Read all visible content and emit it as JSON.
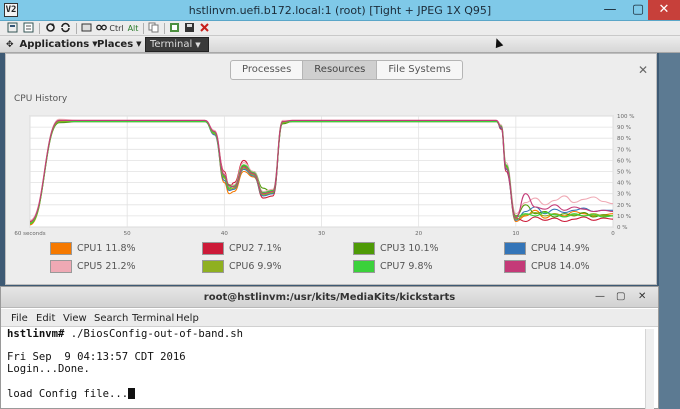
{
  "vnc": {
    "title": "hstlinvm.uefi.b172.local:1 (root) [Tight + JPEG 1X Q95]",
    "app_icon": "V2",
    "controls": {
      "minimize": "—",
      "maximize": "▢",
      "close": "✕"
    },
    "toolbar": {
      "icons": [
        "options-icon",
        "info-icon",
        "refresh-icon",
        "refresh-alt-icon",
        "ctrl-alt-del-icon",
        "ctrl-esc-icon",
        "ctrl-icon",
        "alt-icon",
        "copy-icon",
        "paste-icon",
        "new-connection-icon",
        "save-icon",
        "disconnect-icon"
      ],
      "ctrl_label": "Ctrl",
      "alt_label": "Alt"
    }
  },
  "panel": {
    "applications": "Applications",
    "places": "Places",
    "terminal_tasklist": "Terminal"
  },
  "sysmon": {
    "tabs": [
      "Processes",
      "Resources",
      "File Systems"
    ],
    "active_tab": "Resources",
    "section_title": "CPU History",
    "close_glyph": "✕"
  },
  "chart_data": {
    "type": "line",
    "title": "CPU History",
    "x_ticks": [
      "60 seconds",
      "50",
      "40",
      "30",
      "20",
      "10",
      "0"
    ],
    "y_ticks": [
      "100 %",
      "90 %",
      "80 %",
      "70 %",
      "60 %",
      "50 %",
      "40 %",
      "30 %",
      "20 %",
      "10 %",
      "0 %"
    ],
    "x_range": [
      60,
      0
    ],
    "ylim": [
      0,
      100
    ],
    "grid": true,
    "legend_position": "bottom",
    "x": [
      60,
      57,
      55,
      50,
      45,
      42,
      41,
      40,
      39.5,
      39,
      38,
      37,
      36,
      35,
      34,
      33,
      32,
      31,
      25,
      20,
      15,
      12,
      11.5,
      11,
      10,
      9,
      8,
      7,
      6,
      5,
      4,
      3,
      2,
      1,
      0
    ],
    "series": [
      {
        "name": "CPU1",
        "value_label": "CPU1  11.8%",
        "color": "#f57900",
        "values": [
          2,
          96,
          95,
          95,
          95,
          95,
          85,
          40,
          30,
          32,
          50,
          45,
          30,
          32,
          95,
          95,
          95,
          95,
          95,
          95,
          95,
          95,
          90,
          55,
          5,
          10,
          15,
          8,
          12,
          10,
          14,
          12,
          10,
          11,
          12
        ]
      },
      {
        "name": "CPU2",
        "value_label": "CPU2  7.1%",
        "color": "#cc1a38",
        "values": [
          5,
          96,
          96,
          96,
          96,
          96,
          86,
          50,
          35,
          40,
          60,
          48,
          26,
          28,
          95,
          96,
          96,
          96,
          96,
          96,
          96,
          96,
          88,
          50,
          8,
          5,
          9,
          6,
          8,
          5,
          7,
          9,
          6,
          8,
          7
        ]
      },
      {
        "name": "CPU3",
        "value_label": "CPU3  10.1%",
        "color": "#4e9a06",
        "values": [
          3,
          94,
          95,
          95,
          95,
          95,
          84,
          45,
          38,
          36,
          55,
          50,
          35,
          30,
          93,
          95,
          95,
          95,
          95,
          95,
          95,
          95,
          90,
          55,
          10,
          20,
          12,
          14,
          9,
          12,
          10,
          13,
          9,
          11,
          10
        ]
      },
      {
        "name": "CPU4",
        "value_label": "CPU4  14.9%",
        "color": "#3475b8",
        "values": [
          4,
          95,
          95,
          95,
          95,
          95,
          83,
          42,
          33,
          34,
          52,
          46,
          28,
          30,
          94,
          95,
          95,
          95,
          95,
          95,
          95,
          95,
          89,
          52,
          6,
          14,
          18,
          12,
          16,
          13,
          15,
          17,
          14,
          15,
          15
        ]
      },
      {
        "name": "CPU5",
        "value_label": "CPU5  21.2%",
        "color": "#efa9b4",
        "values": [
          6,
          97,
          96,
          96,
          96,
          96,
          87,
          48,
          36,
          38,
          58,
          50,
          32,
          34,
          96,
          96,
          96,
          96,
          96,
          96,
          96,
          96,
          92,
          58,
          12,
          22,
          26,
          20,
          24,
          28,
          22,
          25,
          27,
          23,
          21
        ]
      },
      {
        "name": "CPU6",
        "value_label": "CPU6  9.9%",
        "color": "#8fb020",
        "values": [
          4,
          95,
          95,
          95,
          95,
          95,
          84,
          44,
          34,
          35,
          53,
          47,
          29,
          31,
          94,
          95,
          95,
          95,
          95,
          95,
          95,
          95,
          90,
          54,
          7,
          11,
          13,
          10,
          12,
          9,
          11,
          10,
          12,
          10,
          10
        ]
      },
      {
        "name": "CPU7",
        "value_label": "CPU7  9.8%",
        "color": "#3bd13b",
        "values": [
          3,
          96,
          95,
          95,
          95,
          95,
          85,
          46,
          35,
          37,
          56,
          49,
          31,
          33,
          95,
          95,
          95,
          95,
          95,
          95,
          95,
          95,
          91,
          56,
          9,
          12,
          10,
          13,
          11,
          9,
          12,
          10,
          11,
          9,
          10
        ]
      },
      {
        "name": "CPU8",
        "value_label": "CPU8  14.0%",
        "color": "#c43a78",
        "values": [
          5,
          96,
          96,
          96,
          96,
          96,
          86,
          47,
          37,
          36,
          54,
          48,
          30,
          32,
          95,
          96,
          96,
          96,
          96,
          96,
          96,
          96,
          90,
          53,
          8,
          30,
          18,
          16,
          20,
          15,
          18,
          16,
          14,
          15,
          14
        ]
      }
    ]
  },
  "terminal": {
    "title": "root@hstlinvm:/usr/kits/MediaKits/kickstarts",
    "controls": {
      "minimize": "—",
      "maximize": "▢",
      "close": "✕"
    },
    "menu": [
      "File",
      "Edit",
      "View",
      "Search",
      "Terminal",
      "Help"
    ],
    "prompt": "hstlinvm#",
    "command": " ./BiosConfig-out-of-band.sh",
    "lines": [
      "",
      "Fri Sep  9 04:13:57 CDT 2016",
      "Login...Done.",
      "",
      "load Config file..."
    ]
  }
}
